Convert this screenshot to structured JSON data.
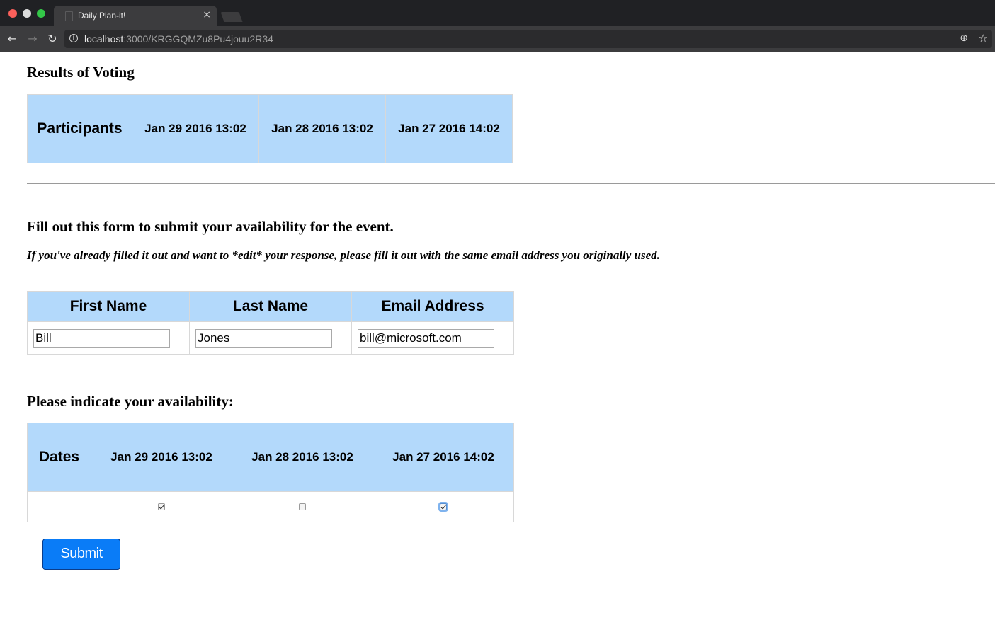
{
  "browser": {
    "tab_title": "Daily Plan-it!",
    "tab_close": "×",
    "url_host": "localhost",
    "url_rest": ":3000/KRGGQMZu8Pu4jouu2R34",
    "icons": {
      "back": "←",
      "forward": "→",
      "reload": "↻",
      "info": "i",
      "zoom": "⊕",
      "star": "☆"
    }
  },
  "results": {
    "heading": "Results of Voting",
    "columns": [
      "Participants",
      "Jan 29 2016 13:02",
      "Jan 28 2016 13:02",
      "Jan 27 2016 14:02"
    ]
  },
  "form": {
    "heading": "Fill out this form to submit your availability for the event.",
    "edit_note": "If you've already filled it out and want to *edit* your response, please fill it out with the same email address you originally used.",
    "columns": [
      "First Name",
      "Last Name",
      "Email Address"
    ],
    "values": {
      "first_name": "Bill",
      "last_name": "Jones",
      "email": "bill@microsoft.com"
    }
  },
  "availability": {
    "heading": "Please indicate your availability:",
    "columns": [
      "Dates",
      "Jan 29 2016 13:02",
      "Jan 28 2016 13:02",
      "Jan 27 2016 14:02"
    ],
    "checked": [
      true,
      false,
      true
    ]
  },
  "submit_label": "Submit",
  "colors": {
    "header_bg": "#b3d9fb",
    "submit_bg": "#0a7cf7",
    "chrome_dark": "#202124"
  }
}
